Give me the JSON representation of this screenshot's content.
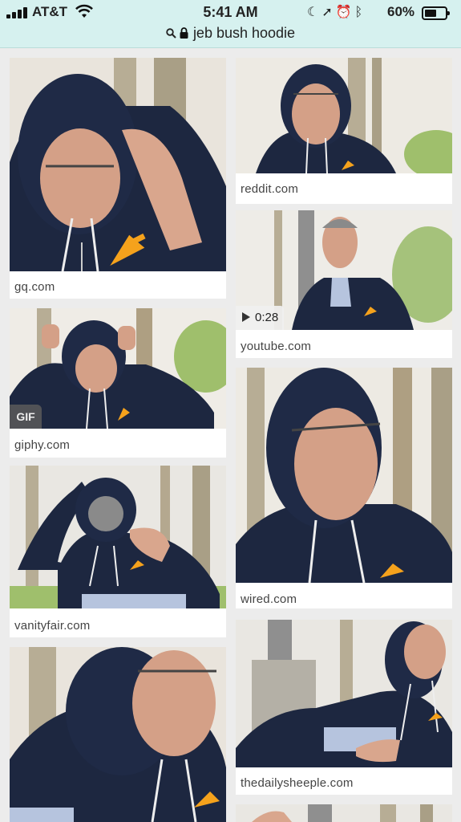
{
  "status_bar": {
    "carrier": "AT&T",
    "time": "5:41 AM",
    "battery_percent": "60%",
    "battery_level": 0.6,
    "icons": [
      "moon-icon",
      "location-arrow-icon",
      "alarm-clock-icon",
      "bluetooth-icon"
    ]
  },
  "url_bar": {
    "query": "jeb bush hoodie"
  },
  "results": [
    {
      "source": "gq.com"
    },
    {
      "source": "reddit.com"
    },
    {
      "source": "youtube.com",
      "duration": "0:28"
    },
    {
      "source": "giphy.com",
      "badge": "GIF"
    },
    {
      "source": "wired.com"
    },
    {
      "source": "vanityfair.com"
    },
    {
      "source": "thedailysheeple.com"
    },
    {
      "source": ""
    }
  ],
  "colors": {
    "header_bg": "#d6f1ef",
    "hoodie": "#1d2740",
    "pin": "#f5a21c",
    "page_bg": "#ececec"
  }
}
